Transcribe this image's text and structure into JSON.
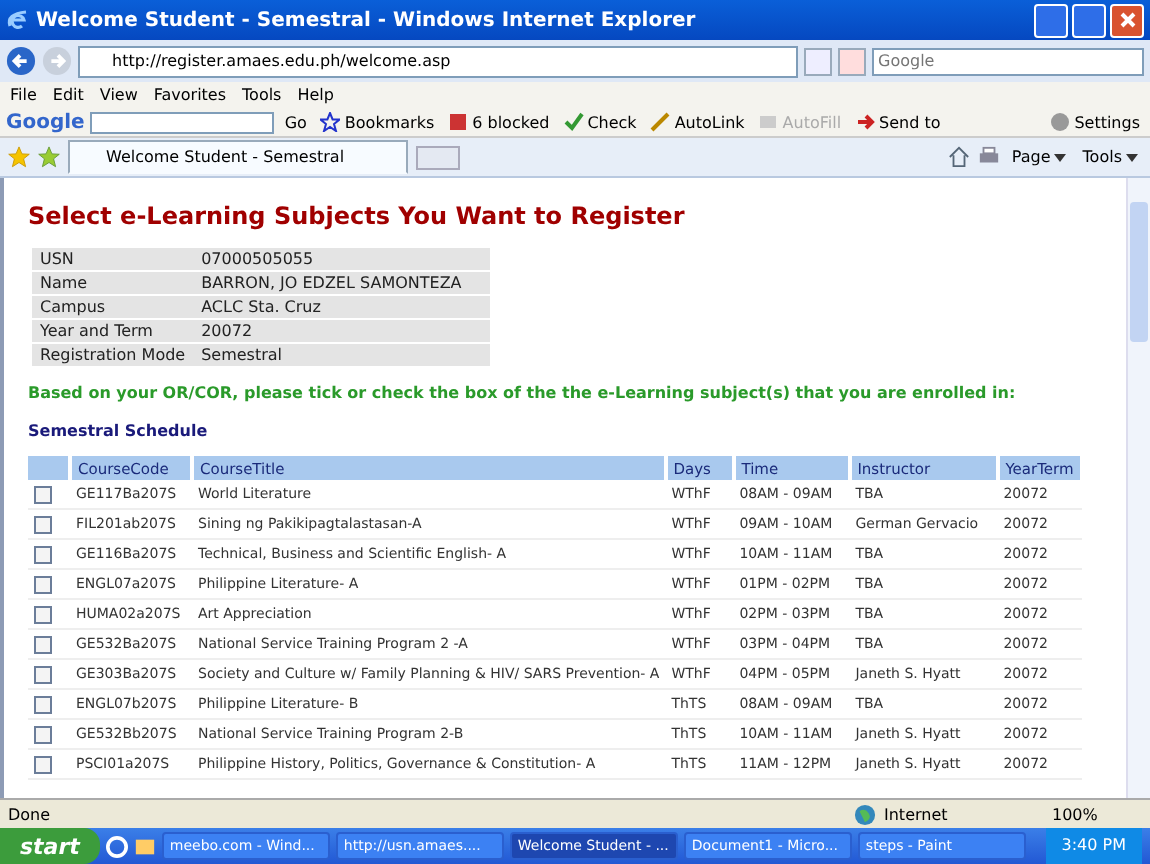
{
  "window": {
    "title": "Welcome Student - Semestral - Windows Internet Explorer"
  },
  "address_bar": {
    "url": "http://register.amaes.edu.ph/welcome.asp",
    "search_placeholder": "Google"
  },
  "menu": [
    "File",
    "Edit",
    "View",
    "Favorites",
    "Tools",
    "Help"
  ],
  "google_toolbar": {
    "logo": "Google",
    "go": "Go",
    "items": [
      {
        "kind": "star",
        "label": "Bookmarks",
        "disabled": false
      },
      {
        "kind": "block",
        "label": "6 blocked",
        "disabled": false
      },
      {
        "kind": "check",
        "label": "Check",
        "disabled": false
      },
      {
        "kind": "link",
        "label": "AutoLink",
        "disabled": false
      },
      {
        "kind": "fill",
        "label": "AutoFill",
        "disabled": true
      },
      {
        "kind": "send",
        "label": "Send to",
        "disabled": false
      }
    ],
    "settings": "Settings"
  },
  "tabs": [
    {
      "label": "Welcome Student - Semestral",
      "selected": true
    }
  ],
  "command_bar": [
    "Page",
    "Tools"
  ],
  "page": {
    "heading": "Select e-Learning Subjects You Want to Register",
    "info": [
      {
        "label": "USN",
        "value": "07000505055"
      },
      {
        "label": "Name",
        "value": "BARRON, JO EDZEL SAMONTEZA"
      },
      {
        "label": "Campus",
        "value": "ACLC Sta. Cruz"
      },
      {
        "label": "Year and Term",
        "value": "20072"
      },
      {
        "label": "Registration Mode",
        "value": "Semestral"
      }
    ],
    "instruction": "Based on your OR/COR, please tick or check the box of the the e-Learning subject(s) that you are enrolled in:",
    "schedule_title": "Semestral Schedule",
    "table": {
      "columns": [
        "CourseCode",
        "CourseTitle",
        "Days",
        "Time",
        "Instructor",
        "YearTerm"
      ],
      "rows": [
        {
          "checked": false,
          "cells": [
            "GE117Ba207S",
            "World Literature",
            "WThF",
            "08AM - 09AM",
            "TBA",
            "20072"
          ]
        },
        {
          "checked": false,
          "cells": [
            "FIL201ab207S",
            "Sining ng Pakikipagtalastasan-A",
            "WThF",
            "09AM - 10AM",
            "German Gervacio",
            "20072"
          ]
        },
        {
          "checked": false,
          "cells": [
            "GE116Ba207S",
            "Technical, Business and Scientific English- A",
            "WThF",
            "10AM - 11AM",
            "TBA",
            "20072"
          ]
        },
        {
          "checked": false,
          "cells": [
            "ENGL07a207S",
            "Philippine Literature- A",
            "WThF",
            "01PM - 02PM",
            "TBA",
            "20072"
          ]
        },
        {
          "checked": false,
          "cells": [
            "HUMA02a207S",
            "Art Appreciation",
            "WThF",
            "02PM - 03PM",
            "TBA",
            "20072"
          ]
        },
        {
          "checked": false,
          "cells": [
            "GE532Ba207S",
            "National Service Training Program 2 -A",
            "WThF",
            "03PM - 04PM",
            "TBA",
            "20072"
          ]
        },
        {
          "checked": false,
          "cells": [
            "GE303Ba207S",
            "Society and Culture w/ Family Planning & HIV/ SARS Prevention- A",
            "WThF",
            "04PM - 05PM",
            "Janeth S. Hyatt",
            "20072"
          ]
        },
        {
          "checked": false,
          "cells": [
            "ENGL07b207S",
            "Philippine Literature- B",
            "ThTS",
            "08AM - 09AM",
            "TBA",
            "20072"
          ]
        },
        {
          "checked": false,
          "cells": [
            "GE532Bb207S",
            "National Service Training Program 2-B",
            "ThTS",
            "10AM - 11AM",
            "Janeth S. Hyatt",
            "20072"
          ]
        },
        {
          "checked": false,
          "cells": [
            "PSCI01a207S",
            "Philippine History, Politics, Governance & Constitution- A",
            "ThTS",
            "11AM - 12PM",
            "Janeth S. Hyatt",
            "20072"
          ]
        }
      ]
    }
  },
  "status_bar": {
    "text": "Done",
    "zone": "Internet",
    "zoom": "100%"
  },
  "taskbar": {
    "start": "start",
    "tasks": [
      {
        "label": "meebo.com - Wind...",
        "selected": false
      },
      {
        "label": "http://usn.amaes....",
        "selected": false
      },
      {
        "label": "Welcome Student - ...",
        "selected": true
      },
      {
        "label": "Document1 - Micro...",
        "selected": false
      },
      {
        "label": "steps - Paint",
        "selected": false
      }
    ],
    "clock": "3:40 PM"
  }
}
